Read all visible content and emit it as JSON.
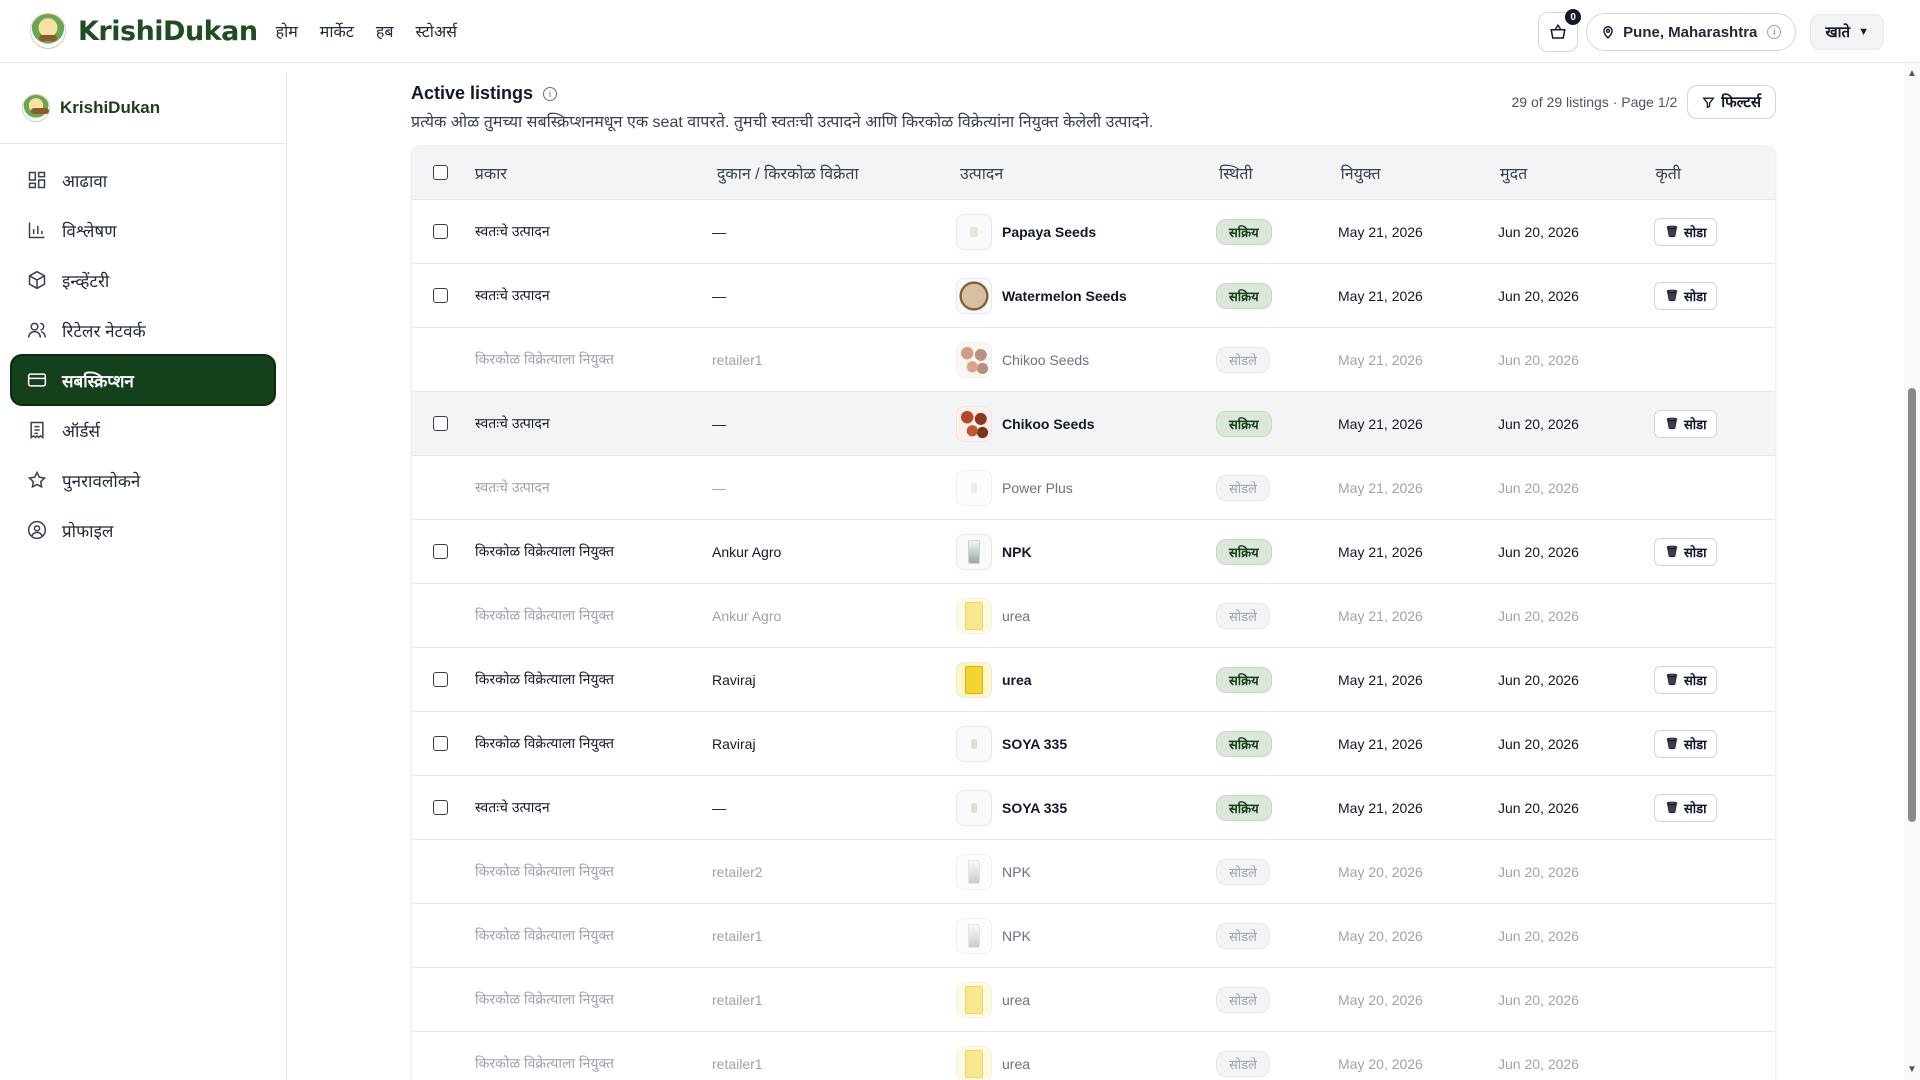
{
  "header": {
    "brand": "KrishiDukan",
    "nav": [
      "होम",
      "मार्केट",
      "हब",
      "स्टोअर्स"
    ],
    "cart_count": "0",
    "location": "Pune, Maharashtra",
    "account_label": "खाते"
  },
  "sidebar": {
    "brand": "KrishiDukan",
    "items": [
      {
        "label": "आढावा",
        "icon": "grid-icon"
      },
      {
        "label": "विश्लेषण",
        "icon": "bar-chart-icon"
      },
      {
        "label": "इन्व्हेंटरी",
        "icon": "box-icon"
      },
      {
        "label": "रिटेलर नेटवर्क",
        "icon": "users-icon"
      },
      {
        "label": "सबस्क्रिप्शन",
        "icon": "card-icon",
        "active": true
      },
      {
        "label": "ऑर्डर्स",
        "icon": "receipt-icon"
      },
      {
        "label": "पुनरावलोकने",
        "icon": "star-icon"
      },
      {
        "label": "प्रोफाइल",
        "icon": "user-circle-icon"
      }
    ]
  },
  "listings": {
    "title": "Active listings",
    "subtitle": "प्रत्येक ओळ तुमच्या सबस्क्रिप्शनमधून एक seat वापरते. तुमची स्वतःची उत्पादने आणि किरकोळ विक्रेत्यांना नियुक्त केलेली उत्पादने.",
    "count": "29 of 29 listings",
    "page": "· Page 1/2",
    "filter_label": "फिल्टर्स",
    "columns": {
      "type": "प्रकार",
      "shop": "दुकान / किरकोळ विक्रेता",
      "product": "उत्पादन",
      "status": "स्थिती",
      "assigned": "नियुक्त",
      "expiry": "मुदत",
      "action": "कृती"
    },
    "leave_label": "सोडा",
    "rows": [
      {
        "type": "स्वतःचे उत्पादन",
        "shop": "—",
        "product": "Papaya Seeds",
        "thumb": "seeds-papaya",
        "status": "सक्रिय",
        "assigned": "May 21, 2026",
        "expiry": "Jun 20, 2026",
        "active": true
      },
      {
        "type": "स्वतःचे उत्पादन",
        "shop": "—",
        "product": "Watermelon Seeds",
        "thumb": "seeds-melon",
        "status": "सक्रिय",
        "assigned": "May 21, 2026",
        "expiry": "Jun 20, 2026",
        "active": true
      },
      {
        "type": "किरकोळ विक्रेत्याला नियुक्त",
        "shop": "retailer1",
        "product": "Chikoo Seeds",
        "thumb": "seeds-chikoo",
        "status": "सोडले",
        "assigned": "May 21, 2026",
        "expiry": "Jun 20, 2026",
        "active": false
      },
      {
        "type": "स्वतःचे उत्पादन",
        "shop": "—",
        "product": "Chikoo Seeds",
        "thumb": "seeds-chikoo",
        "status": "सक्रिय",
        "assigned": "May 21, 2026",
        "expiry": "Jun 20, 2026",
        "active": true,
        "hover": true
      },
      {
        "type": "स्वतःचे उत्पादन",
        "shop": "—",
        "product": "Power Plus",
        "thumb": "soya",
        "status": "सोडले",
        "assigned": "May 21, 2026",
        "expiry": "Jun 20, 2026",
        "active": false
      },
      {
        "type": "किरकोळ विक्रेत्याला नियुक्त",
        "shop": "Ankur Agro",
        "product": "NPK",
        "thumb": "npk",
        "status": "सक्रिय",
        "assigned": "May 21, 2026",
        "expiry": "Jun 20, 2026",
        "active": true
      },
      {
        "type": "किरकोळ विक्रेत्याला नियुक्त",
        "shop": "Ankur Agro",
        "product": "urea",
        "thumb": "urea",
        "status": "सोडले",
        "assigned": "May 21, 2026",
        "expiry": "Jun 20, 2026",
        "active": false
      },
      {
        "type": "किरकोळ विक्रेत्याला नियुक्त",
        "shop": "Raviraj",
        "product": "urea",
        "thumb": "urea",
        "status": "सक्रिय",
        "assigned": "May 21, 2026",
        "expiry": "Jun 20, 2026",
        "active": true
      },
      {
        "type": "किरकोळ विक्रेत्याला नियुक्त",
        "shop": "Raviraj",
        "product": "SOYA 335",
        "thumb": "soya",
        "status": "सक्रिय",
        "assigned": "May 21, 2026",
        "expiry": "Jun 20, 2026",
        "active": true
      },
      {
        "type": "स्वतःचे उत्पादन",
        "shop": "—",
        "product": "SOYA 335",
        "thumb": "soya",
        "status": "सक्रिय",
        "assigned": "May 21, 2026",
        "expiry": "Jun 20, 2026",
        "active": true
      },
      {
        "type": "किरकोळ विक्रेत्याला नियुक्त",
        "shop": "retailer2",
        "product": "NPK",
        "thumb": "npk",
        "status": "सोडले",
        "assigned": "May 20, 2026",
        "expiry": "Jun 20, 2026",
        "active": false
      },
      {
        "type": "किरकोळ विक्रेत्याला नियुक्त",
        "shop": "retailer1",
        "product": "NPK",
        "thumb": "npk",
        "status": "सोडले",
        "assigned": "May 20, 2026",
        "expiry": "Jun 20, 2026",
        "active": false
      },
      {
        "type": "किरकोळ विक्रेत्याला नियुक्त",
        "shop": "retailer1",
        "product": "urea",
        "thumb": "urea",
        "status": "सोडले",
        "assigned": "May 20, 2026",
        "expiry": "Jun 20, 2026",
        "active": false
      },
      {
        "type": "किरकोळ विक्रेत्याला नियुक्त",
        "shop": "retailer1",
        "product": "urea",
        "thumb": "urea",
        "status": "सोडले",
        "assigned": "May 20, 2026",
        "expiry": "Jun 20, 2026",
        "active": false
      }
    ]
  }
}
